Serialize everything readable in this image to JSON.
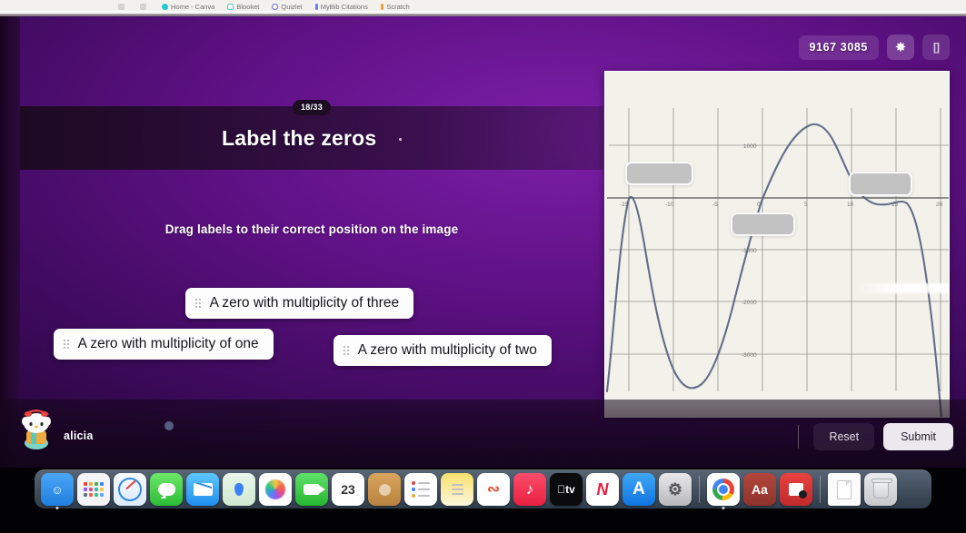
{
  "browser": {
    "bookmarks": [
      {
        "label": "",
        "icon": "dim-icon"
      },
      {
        "label": "",
        "icon": "dim-icon"
      },
      {
        "label": "Home - Canva",
        "icon": "canva-icon"
      },
      {
        "label": "Blooket",
        "icon": "blooket-icon"
      },
      {
        "label": "Quizlet",
        "icon": "quizlet-icon"
      },
      {
        "label": "MyBib Citations",
        "icon": "mybib-icon"
      },
      {
        "label": "Scratch",
        "icon": "scratch-icon"
      }
    ]
  },
  "hud": {
    "game_code": "9167 3085",
    "gear_icon": "gear-icon",
    "fullscreen_icon": "expand-icon"
  },
  "question": {
    "progress": "18/33",
    "title": "Label the zeros",
    "instruction": "Drag labels to their correct position on the image"
  },
  "labels": [
    {
      "id": "three",
      "text": "A zero with multiplicity of three",
      "handle_icon": "drag-handle-icon"
    },
    {
      "id": "one",
      "text": "A zero with multiplicity of one",
      "handle_icon": "drag-handle-icon"
    },
    {
      "id": "two",
      "text": "A zero with multiplicity of two",
      "handle_icon": "drag-handle-icon"
    }
  ],
  "graph": {
    "drop_zones": [
      {
        "id": "left",
        "value": ""
      },
      {
        "id": "mid",
        "value": ""
      },
      {
        "id": "right",
        "value": ""
      }
    ]
  },
  "chart_data": {
    "type": "line",
    "title": "",
    "xlabel": "",
    "ylabel": "",
    "xlim": [
      -18,
      20
    ],
    "ylim": [
      -3800,
      1800
    ],
    "x_ticks": [
      -15,
      -10,
      -5,
      0,
      5,
      10,
      15,
      20
    ],
    "y_ticks": [
      1000,
      0,
      -1000,
      -2000,
      -3000
    ],
    "grid": true,
    "legend": "none",
    "series": [
      {
        "name": "polynomial",
        "description": "Polynomial with a zero of multiplicity two at x = -15, a zero of multiplicity one at x = 0, and a zero of multiplicity three at x = 15",
        "zeros": [
          {
            "x": -15,
            "multiplicity": 2,
            "behavior": "touches-and-turns"
          },
          {
            "x": 0,
            "multiplicity": 1,
            "behavior": "crosses"
          },
          {
            "x": 15,
            "multiplicity": 3,
            "behavior": "flattens-and-crosses"
          }
        ],
        "x": [
          -18,
          -17,
          -16,
          -15,
          -14,
          -13,
          -12,
          -11,
          -10,
          -9,
          -8,
          -7,
          -6,
          -5,
          -4,
          -3,
          -2,
          -1,
          0,
          1,
          2,
          3,
          4,
          5,
          6,
          7,
          8,
          9,
          10,
          11,
          12,
          13,
          14,
          15,
          16,
          17,
          18,
          19,
          20
        ],
        "y": [
          -3400,
          -1600,
          -450,
          0,
          -260,
          -870,
          -1670,
          -2500,
          -3180,
          -3620,
          -3780,
          -3660,
          -3300,
          -2740,
          -2030,
          -1230,
          -400,
          380,
          0,
          560,
          980,
          1280,
          1480,
          1600,
          1670,
          1690,
          1640,
          1520,
          1330,
          1080,
          790,
          480,
          190,
          0,
          -180,
          -560,
          -1400,
          -2700,
          -3700
        ]
      }
    ]
  },
  "footer": {
    "username": "alicia",
    "avatar_icon": "hello-kitty-avatar-icon",
    "reset_label": "Reset",
    "submit_label": "Submit"
  },
  "dock": {
    "left_items": [
      {
        "name": "finder",
        "label": "Finder"
      },
      {
        "name": "launchpad",
        "label": "Launchpad"
      },
      {
        "name": "safari",
        "label": "Safari"
      },
      {
        "name": "messages",
        "label": "Messages"
      },
      {
        "name": "mail",
        "label": "Mail"
      },
      {
        "name": "maps",
        "label": "Maps"
      },
      {
        "name": "photos",
        "label": "Photos"
      },
      {
        "name": "facetime",
        "label": "FaceTime"
      },
      {
        "name": "calendar",
        "label": "23"
      },
      {
        "name": "contacts",
        "label": "Contacts"
      },
      {
        "name": "reminders",
        "label": "Reminders"
      },
      {
        "name": "notes",
        "label": "Notes"
      },
      {
        "name": "freeform",
        "label": "Freeform"
      },
      {
        "name": "music",
        "label": "Music"
      },
      {
        "name": "appletv",
        "label": "tv"
      },
      {
        "name": "news",
        "label": "N"
      },
      {
        "name": "appstore",
        "label": "A"
      },
      {
        "name": "settings",
        "label": "Settings"
      }
    ],
    "right_items": [
      {
        "name": "chrome",
        "label": "Chrome"
      },
      {
        "name": "dictionary",
        "label": "Aa"
      },
      {
        "name": "keynote",
        "label": "Keynote"
      }
    ],
    "tail_items": [
      {
        "name": "document",
        "label": "Document"
      },
      {
        "name": "trash",
        "label": "Trash"
      }
    ]
  }
}
